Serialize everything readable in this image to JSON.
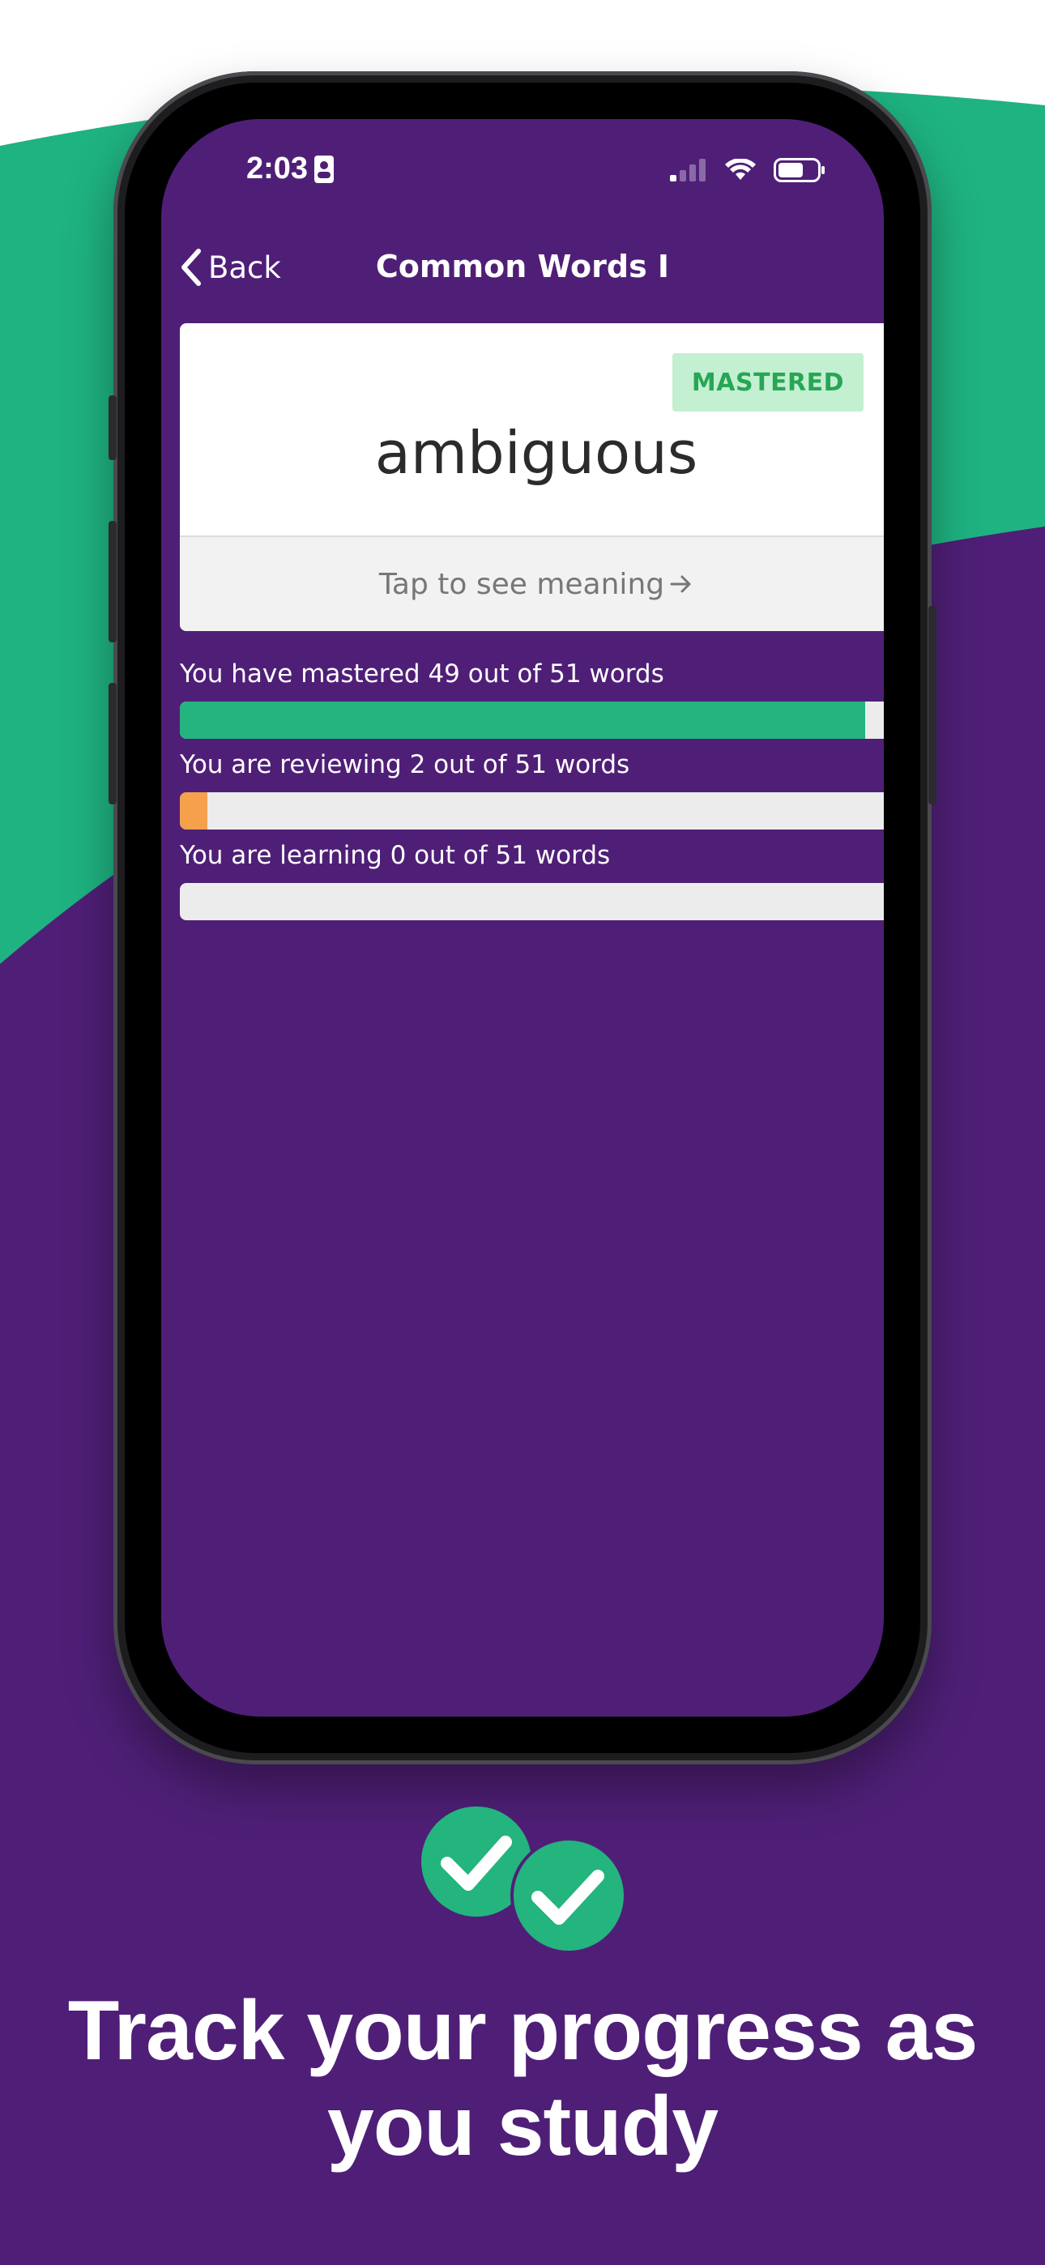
{
  "colors": {
    "background_purple": "#4f1f77",
    "accent_green": "#1fb381",
    "mastered_bar": "#24b47e",
    "reviewing_bar": "#f5a04d",
    "learning_bar": "#bdbdbd",
    "badge_bg": "#c2f0d0",
    "badge_text": "#27a656"
  },
  "status_bar": {
    "time": "2:03",
    "icons": [
      "contact-card-icon",
      "cellular-signal-icon",
      "wifi-icon",
      "battery-icon"
    ]
  },
  "nav": {
    "back_label": "Back",
    "title": "Common Words I"
  },
  "card": {
    "badge": "MASTERED",
    "word": "ambiguous",
    "tap_label": "Tap to see meaning"
  },
  "progress": [
    {
      "label": "You have mastered 49 out of 51 words",
      "fraction": 0.9608,
      "color_key": "mastered_bar"
    },
    {
      "label": "You are reviewing 2 out of 51 words",
      "fraction": 0.0392,
      "color_key": "reviewing_bar"
    },
    {
      "label": "You are learning 0 out of 51 words",
      "fraction": 0.0,
      "color_key": "learning_bar"
    }
  ],
  "caption": {
    "line1": "Track your progress as",
    "line2": "you study"
  }
}
